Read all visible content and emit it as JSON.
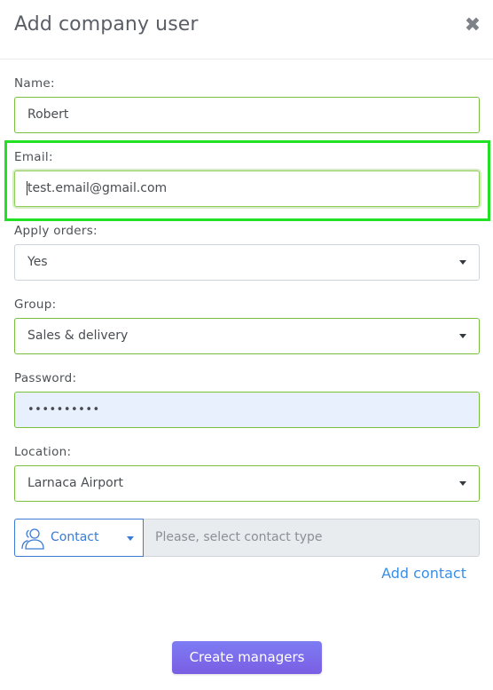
{
  "modal": {
    "title": "Add company user",
    "close_symbol": "✖"
  },
  "form": {
    "name": {
      "label": "Name:",
      "value": "Robert"
    },
    "email": {
      "label": "Email:",
      "value": "test.email@gmail.com"
    },
    "apply_orders": {
      "label": "Apply orders:",
      "value": "Yes"
    },
    "group": {
      "label": "Group:",
      "value": "Sales & delivery"
    },
    "password": {
      "label": "Password:",
      "value": "••••••••••"
    },
    "location": {
      "label": "Location:",
      "value": "Larnaca Airport"
    },
    "contact": {
      "type_button_label": "Contact",
      "placeholder": "Please, select contact type",
      "add_label": "Add contact"
    }
  },
  "footer": {
    "submit_label": "Create managers"
  },
  "colors": {
    "valid_border": "#7bbf3f",
    "highlight": "#22e024",
    "link_blue": "#3a8ee6",
    "button_purple": "#7a6cec",
    "password_bg": "#e8f0fe"
  },
  "icons": {
    "close": "close-icon",
    "contact": "users-icon",
    "dropdown": "chevron-down-icon"
  }
}
